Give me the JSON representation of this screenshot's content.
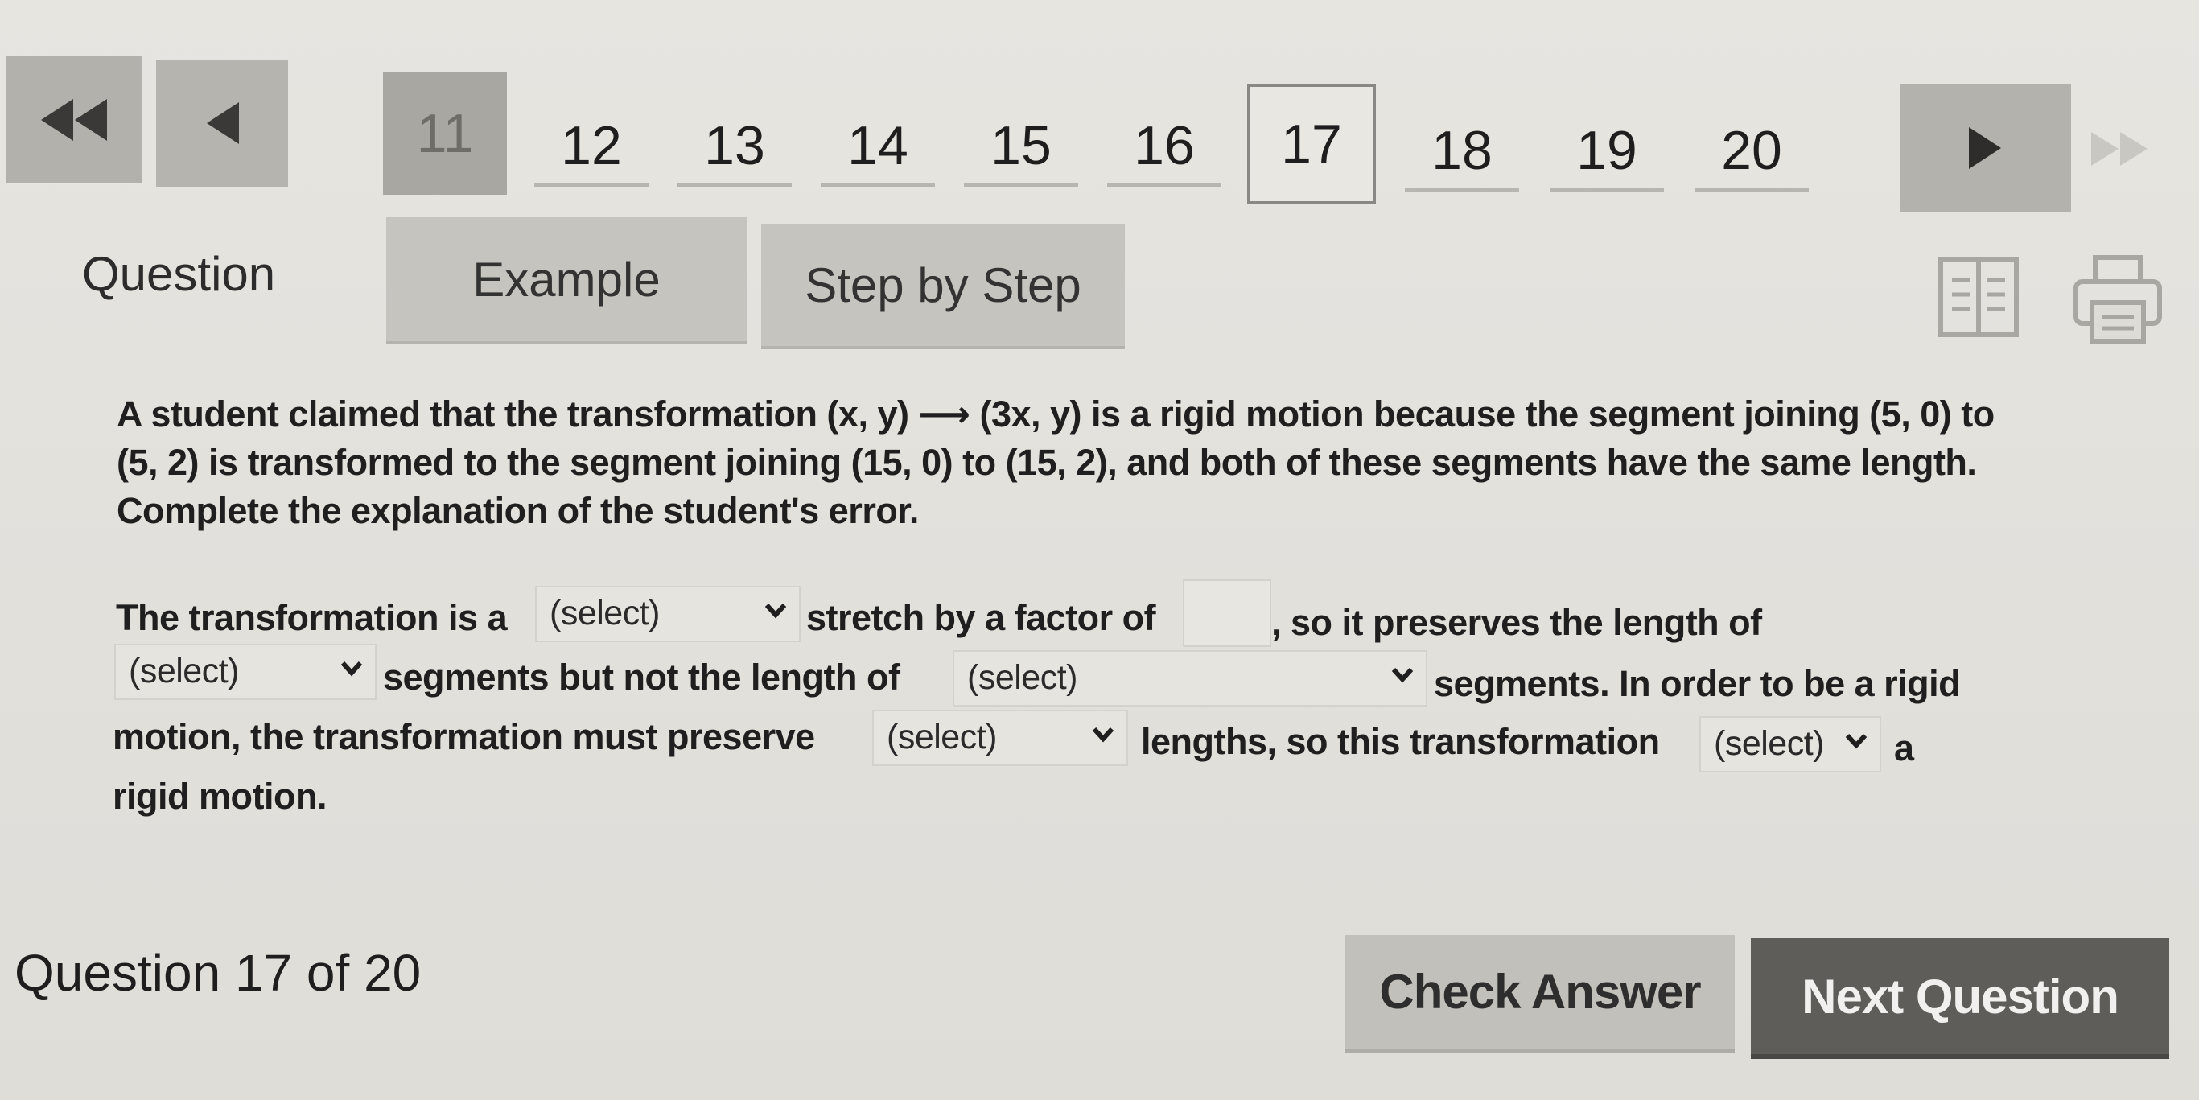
{
  "navigation": {
    "question_numbers": [
      "11",
      "12",
      "13",
      "14",
      "15",
      "16",
      "17",
      "18",
      "19",
      "20"
    ],
    "current": "17"
  },
  "tabs": {
    "question": "Question",
    "example": "Example",
    "step_by_step": "Step by Step"
  },
  "icons": {
    "first": "double-left-arrow-icon",
    "prev": "left-arrow-icon",
    "next": "right-arrow-icon",
    "last": "double-right-arrow-icon",
    "book": "book-icon",
    "print": "printer-icon"
  },
  "prompt": {
    "text": "A student claimed that the transformation (x, y) ⟶ (3x, y) is a rigid motion because the segment joining (5, 0) to (5, 2) is transformed to the segment joining (15, 0) to (15, 2), and both of these segments have the same length. Complete the explanation of the student's error."
  },
  "explanation": {
    "t1": "The transformation is a",
    "t2": "stretch by a factor of",
    "t3": ", so it preserves the length of",
    "t4": "segments but not the length of",
    "t5": "segments. In order to be a rigid",
    "t6": "motion, the transformation must preserve",
    "t7": "lengths, so this transformation",
    "t8": "a",
    "t9": "rigid motion.",
    "select_1": "(select)",
    "select_2": "(select)",
    "select_3": "(select)",
    "select_4": "(select)",
    "select_5": "(select)",
    "factor_value": ""
  },
  "footer": {
    "counter": "Question 17 of 20",
    "check_answer": "Check Answer",
    "next_question": "Next Question"
  }
}
